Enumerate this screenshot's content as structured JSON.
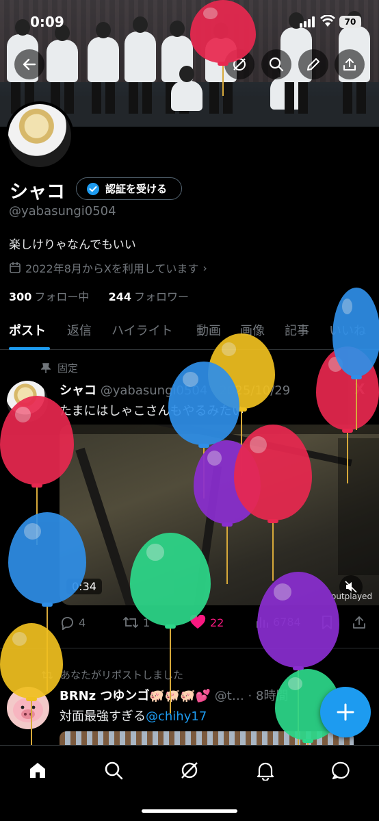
{
  "status_bar": {
    "time": "0:09",
    "battery": "70"
  },
  "profile": {
    "name": "シャコ",
    "verify_button": "認証を受ける",
    "handle": "@yabasungi0504",
    "bio": "楽しけりゃなんでもいい",
    "joined": "2022年8月からXを利用しています",
    "following_count": "300",
    "following_label": "フォロー中",
    "followers_count": "244",
    "followers_label": "フォロワー"
  },
  "tabs": [
    "ポスト",
    "返信",
    "ハイライト",
    "動画",
    "画像",
    "記事",
    "いいね"
  ],
  "pinned_post": {
    "pin_label": "固定",
    "author": "シャコ",
    "handle_date": "@yabasungi0504 · 2025/10/29",
    "text": "たまにはしゃこさんもやるみたい",
    "duration": "0:34",
    "watermark": "outplayed",
    "replies": "4",
    "reposts": "1",
    "likes": "22",
    "views": "6784"
  },
  "repost": {
    "label": "あなたがリポストしました",
    "author": "BRNz つゆンゴ🐖🐖🐖💕",
    "handle_time": "@t… · 8時間",
    "text_plain": "対面最強すぎる",
    "mention": "@chihy17"
  },
  "colors": {
    "accent": "#1d9bf0",
    "like": "#f91880",
    "balloon_colors": [
      "#e8284f",
      "#f0c020",
      "#2f8fe8",
      "#8a2ed0",
      "#2dd88a"
    ]
  },
  "icons": [
    "back-arrow-icon",
    "grok-icon",
    "search-icon",
    "edit-icon",
    "share-icon",
    "verified-badge-icon",
    "calendar-icon",
    "pin-icon",
    "x-logo-icon",
    "mute-icon",
    "reply-icon",
    "repost-icon",
    "heart-icon",
    "views-icon",
    "bookmark-icon",
    "plus-icon",
    "home-icon",
    "notifications-icon",
    "messages-icon"
  ]
}
